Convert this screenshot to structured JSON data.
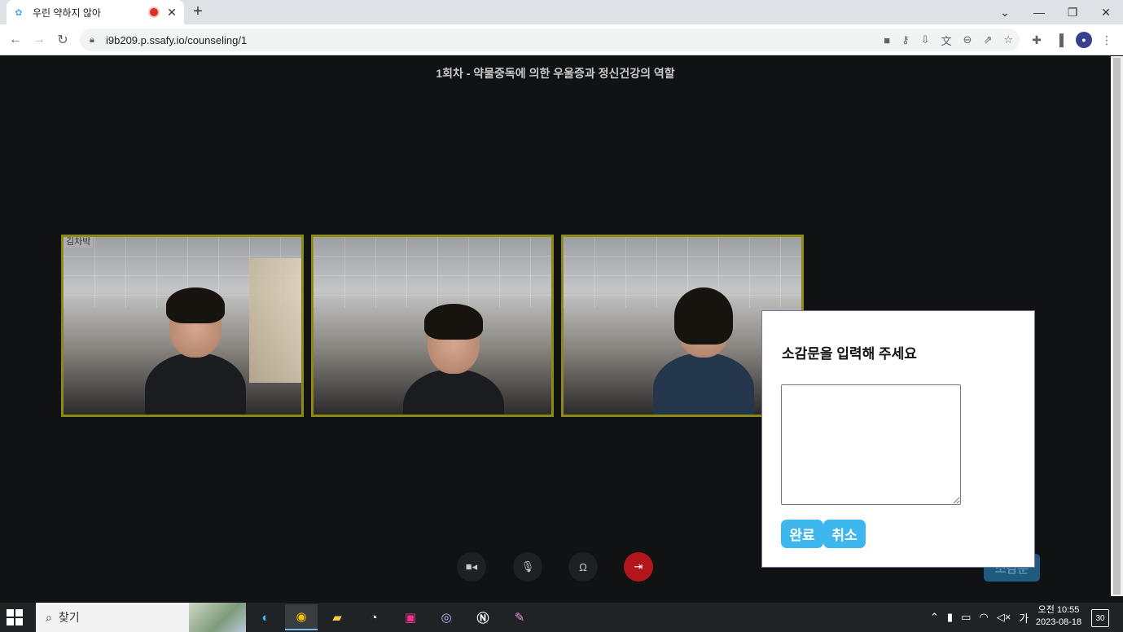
{
  "browser": {
    "tab_title": "우린 약하지 않아",
    "tab_favicon_icon": "app-favicon",
    "new_tab_label": "+",
    "url": "i9b209.p.ssafy.io/counseling/1"
  },
  "page": {
    "session_title": "1회차 - 약물중독에 의한 우울증과 정신건강의 역할",
    "participants": [
      {
        "name": "김차박"
      },
      {
        "name": ""
      },
      {
        "name": ""
      }
    ],
    "controls": [
      "camera-icon",
      "microphone-icon",
      "headphones-icon",
      "leave-icon"
    ],
    "background_button_label": "소감문"
  },
  "modal": {
    "title": "소감문을 입력해 주세요",
    "textarea_value": "",
    "confirm_label": "완료",
    "cancel_label": "취소"
  },
  "taskbar": {
    "search_placeholder": "찾기",
    "ime_label": "가",
    "time": "오전 10:55",
    "date": "2023-08-18",
    "notification_count": "30"
  },
  "colors": {
    "video_border": "#8c8a13",
    "button_accent": "#3eb6ee",
    "leave_button": "#b3151c",
    "page_bg": "#111214"
  }
}
